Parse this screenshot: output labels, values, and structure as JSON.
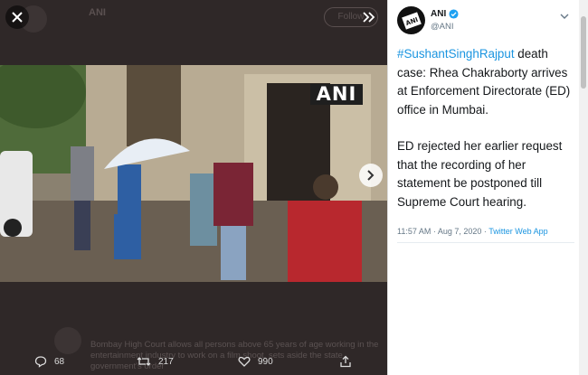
{
  "background_feed": {
    "top_account": "ANI",
    "top_follow_label": "Follow",
    "reply_snippet": "Bombay High Court allows all persons above 65 years of age working in the entertainment industry to work on a film shoot, sets aside the state government's order"
  },
  "controls": {
    "close_icon": "close-icon",
    "collapse_icon": "chevrons-right-icon",
    "next_icon": "chevron-right-icon"
  },
  "media": {
    "watermark": "ANI"
  },
  "actions": {
    "replies": "68",
    "retweets": "217",
    "likes": "990"
  },
  "tweet": {
    "author_name": "ANI",
    "author_handle": "@ANI",
    "hashtag": "#SushantSinghRajput",
    "text_part1": " death case: Rhea Chakraborty arrives at Enforcement Directorate (ED) office in Mumbai.",
    "text_part2": "ED rejected her earlier request that the recording of her statement be postponed till Supreme Court hearing.",
    "timestamp": "11:57 AM · Aug 7, 2020 · ",
    "source": "Twitter Web App"
  },
  "colors": {
    "accent": "#1b95e0",
    "verified": "#1da1f2",
    "overlay": "#2b2525"
  }
}
